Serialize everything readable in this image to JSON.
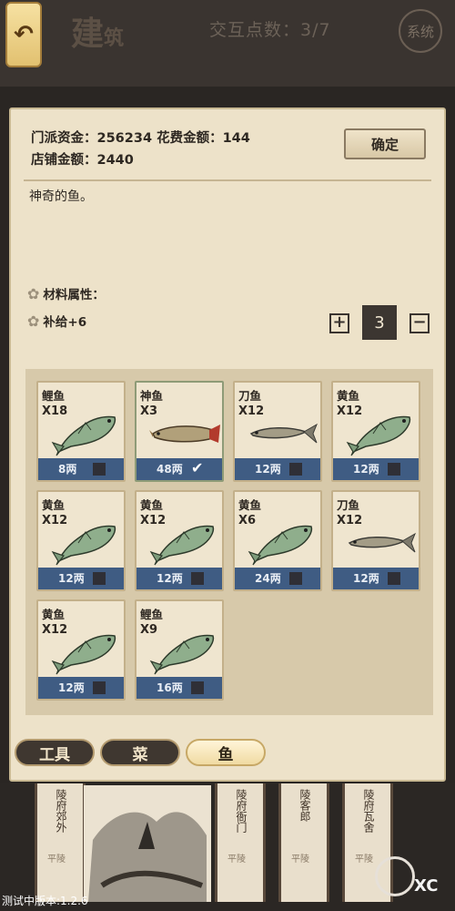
{
  "topbar": {
    "back_icon": "↶",
    "title": "建",
    "title_suffix": "筑",
    "points_label": "交互点数：3/7",
    "system_label": "系统"
  },
  "info": {
    "line1": "门派资金：256234  花费金额：144",
    "line2": "店铺金额：2440",
    "confirm_label": "确定",
    "description": "神奇的鱼。",
    "attr_title": "材料属性：",
    "attr_value": "补给+6",
    "qty_plus": "+",
    "qty": "3",
    "qty_minus": "−"
  },
  "items": [
    {
      "name": "鲤鱼",
      "count": "X18",
      "price": "8两",
      "checked": false,
      "fish": "carp"
    },
    {
      "name": "神鱼",
      "count": "X3",
      "price": "48两",
      "checked": true,
      "fish": "arowana"
    },
    {
      "name": "刀鱼",
      "count": "X12",
      "price": "12两",
      "checked": false,
      "fish": "long"
    },
    {
      "name": "黄鱼",
      "count": "X12",
      "price": "12两",
      "checked": false,
      "fish": "carp"
    },
    {
      "name": "黄鱼",
      "count": "X12",
      "price": "12两",
      "checked": false,
      "fish": "carp"
    },
    {
      "name": "黄鱼",
      "count": "X12",
      "price": "12两",
      "checked": false,
      "fish": "carp"
    },
    {
      "name": "黄鱼",
      "count": "X6",
      "price": "24两",
      "checked": false,
      "fish": "carp"
    },
    {
      "name": "刀鱼",
      "count": "X12",
      "price": "12两",
      "checked": false,
      "fish": "long"
    },
    {
      "name": "黄鱼",
      "count": "X12",
      "price": "12两",
      "checked": false,
      "fish": "carp"
    },
    {
      "name": "鲤鱼",
      "count": "X9",
      "price": "16两",
      "checked": false,
      "fish": "carp"
    }
  ],
  "tabs": [
    {
      "label": "工具"
    },
    {
      "label": "菜"
    },
    {
      "label": "鱼",
      "active": true
    }
  ],
  "scene": {
    "buildings": [
      {
        "name": "陵府郊外",
        "rank": "平陵"
      },
      {
        "name": "陵府衙门",
        "rank": "平陵"
      },
      {
        "name": "陵客郎",
        "rank": "平陵"
      },
      {
        "name": "陵府瓦舍",
        "rank": "平陵"
      }
    ],
    "version": "测试中版本:1.2.6",
    "tool_text": "XC"
  },
  "colors": {
    "card_bar": "#3f5c83",
    "panel": "#ede2c9",
    "accent_gold": "#e2c170"
  }
}
